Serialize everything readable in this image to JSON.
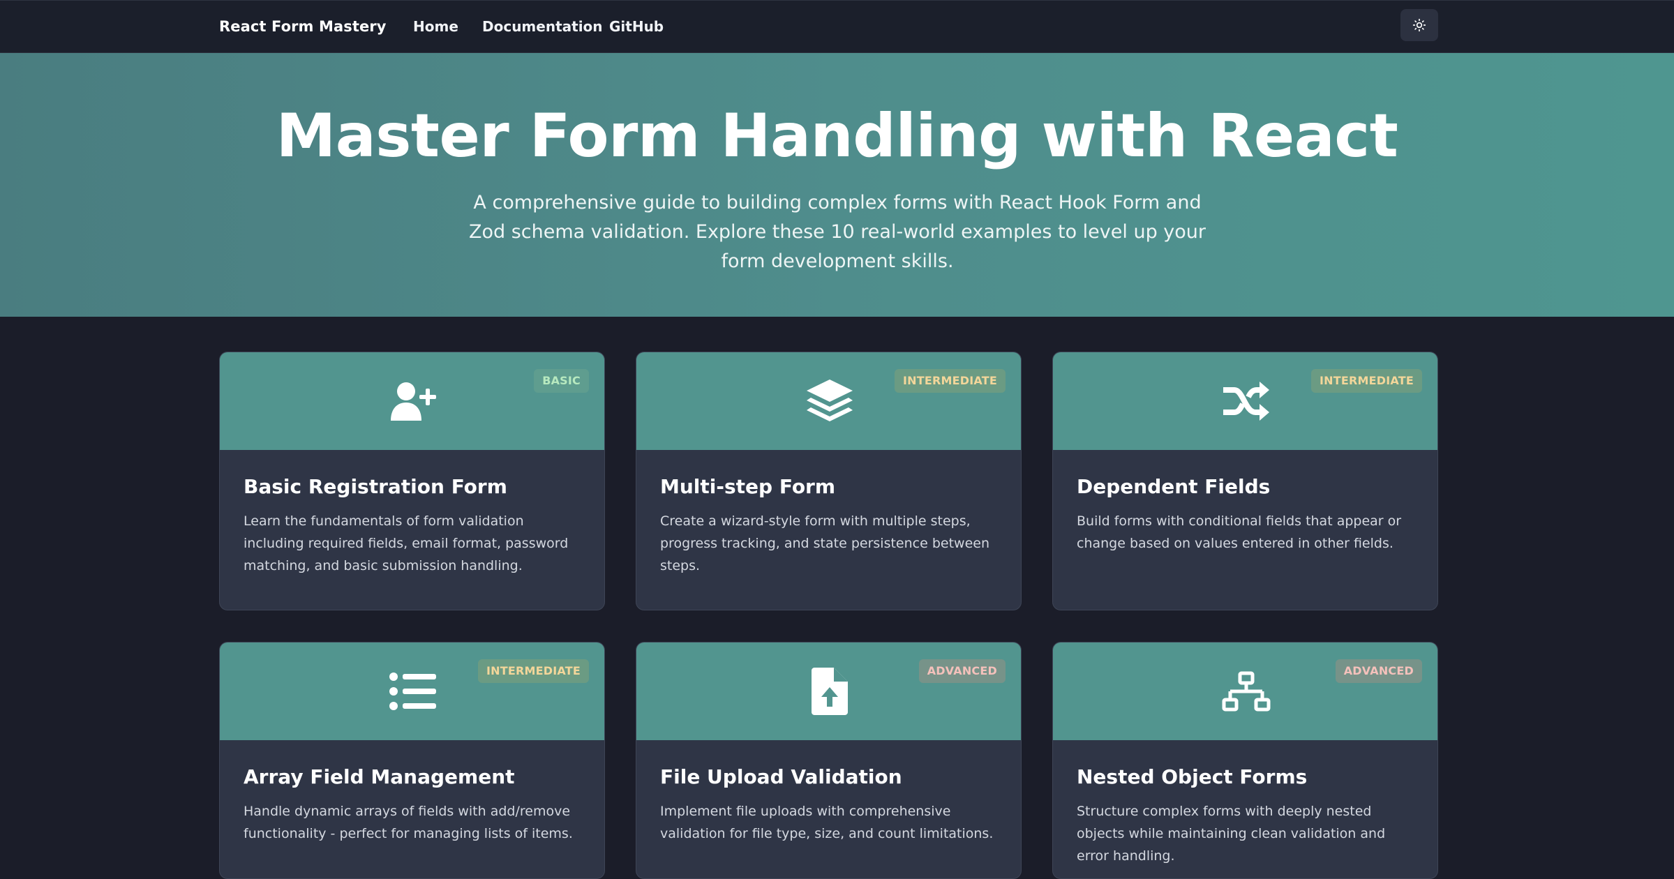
{
  "header": {
    "brand": "React Form Mastery",
    "nav": [
      "Home",
      "Documentation",
      "GitHub"
    ],
    "theme_icon": "sun-icon"
  },
  "hero": {
    "title": "Master Form Handling with React",
    "description": "A comprehensive guide to building complex forms with React Hook Form and Zod schema validation. Explore these 10 real-world examples to level up your form development skills."
  },
  "cards": [
    {
      "icon": "user-plus-icon",
      "badge": "BASIC",
      "title": "Basic Registration Form",
      "description": "Learn the fundamentals of form validation including required fields, email format, password matching, and basic submission handling."
    },
    {
      "icon": "layers-icon",
      "badge": "INTERMEDIATE",
      "title": "Multi-step Form",
      "description": "Create a wizard-style form with multiple steps, progress tracking, and state persistence between steps."
    },
    {
      "icon": "shuffle-icon",
      "badge": "INTERMEDIATE",
      "title": "Dependent Fields",
      "description": "Build forms with conditional fields that appear or change based on values entered in other fields."
    },
    {
      "icon": "list-icon",
      "badge": "INTERMEDIATE",
      "title": "Array Field Management",
      "description": "Handle dynamic arrays of fields with add/remove functionality - perfect for managing lists of items."
    },
    {
      "icon": "file-upload-icon",
      "badge": "ADVANCED",
      "title": "File Upload Validation",
      "description": "Implement file uploads with comprehensive validation for file type, size, and count limitations."
    },
    {
      "icon": "sitemap-icon",
      "badge": "ADVANCED",
      "title": "Nested Object Forms",
      "description": "Structure complex forms with deeply nested objects while maintaining clean validation and error handling."
    }
  ],
  "colors": {
    "background": "#1b1d29",
    "accent": "#52958f",
    "card": "#2f3546",
    "badge_basic": "#b7e9bf",
    "badge_intermediate": "#f3d69a",
    "badge_advanced": "#f4c1bb"
  }
}
